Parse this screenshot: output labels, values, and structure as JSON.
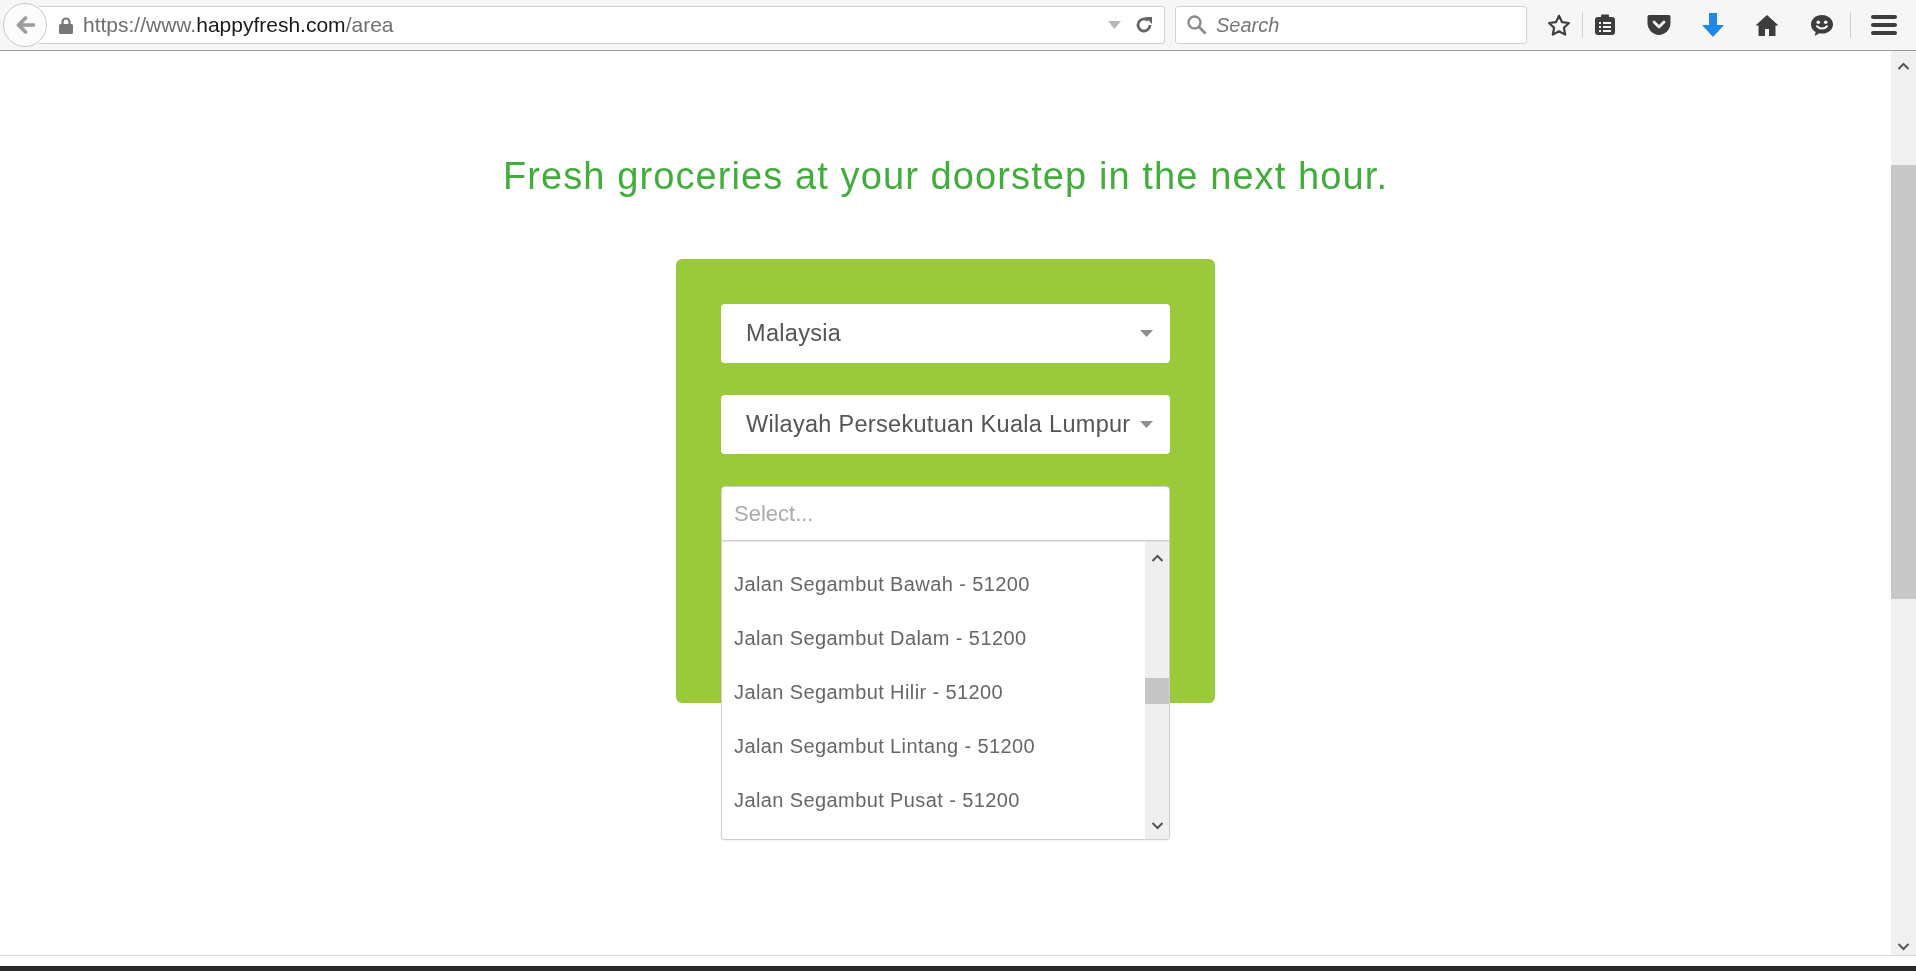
{
  "browser": {
    "address_bar": {
      "scheme": "https://www.",
      "domain": "happyfresh.com",
      "path": "/area"
    },
    "search": {
      "placeholder": "Search"
    }
  },
  "page": {
    "heading": "Fresh groceries at your doorstep in the next hour.",
    "selects": [
      {
        "kind": "dropdown",
        "value": "Malaysia"
      },
      {
        "kind": "dropdown",
        "value": "Wilayah Persekutuan Kuala Lumpur"
      },
      {
        "kind": "combobox",
        "placeholder": "Select...",
        "expanded": true,
        "options": [
          {
            "label": "Jalan Segambut Bawah - 51200",
            "selected": false
          },
          {
            "label": "Jalan Segambut Dalam - 51200",
            "selected": false
          },
          {
            "label": "Jalan Segambut Hilir - 51200",
            "selected": false
          },
          {
            "label": "Jalan Segambut Lintang - 51200",
            "selected": false
          },
          {
            "label": "Jalan Segambut Pusat - 51200",
            "selected": false
          }
        ]
      }
    ]
  }
}
